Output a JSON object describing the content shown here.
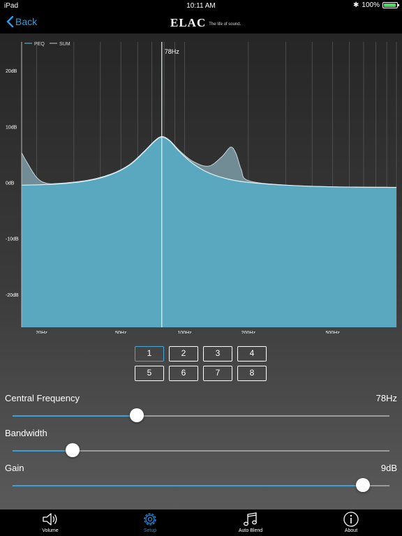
{
  "status_bar": {
    "device": "iPad",
    "time": "10:11 AM",
    "battery": "100%"
  },
  "nav": {
    "back_label": "Back",
    "brand": "ELAC",
    "tagline": "The life of sound."
  },
  "legend": {
    "peq": "PEQ",
    "sum": "SUM"
  },
  "colors": {
    "accent": "#2a9fe6",
    "fill": "#5aa8c0",
    "sum_fill": "#7c9ca7"
  },
  "chart_data": {
    "type": "area",
    "x_scale": "log",
    "xlim": [
      17,
      1000
    ],
    "ylim": [
      -25,
      26
    ],
    "y_ticks": [
      20,
      10,
      0,
      -10,
      -20
    ],
    "y_tick_labels": [
      "20dB",
      "10dB",
      "0dB",
      "-10dB",
      "-20dB"
    ],
    "x_ticks": [
      20,
      50,
      100,
      200,
      500
    ],
    "x_tick_labels": [
      "20Hz",
      "50Hz",
      "100Hz",
      "200Hz",
      "500Hz"
    ],
    "marker": {
      "freq": 78,
      "label": "78Hz"
    },
    "series": [
      {
        "name": "PEQ",
        "x": [
          17,
          25,
          35,
          45,
          55,
          65,
          72,
          78,
          85,
          95,
          110,
          130,
          160,
          200,
          300,
          500,
          1000
        ],
        "y": [
          0.4,
          0.6,
          1.2,
          2.3,
          4.0,
          6.5,
          8.2,
          9.0,
          8.3,
          6.3,
          4.2,
          2.6,
          1.5,
          0.9,
          0.4,
          0.1,
          0.0
        ]
      },
      {
        "name": "SUM",
        "x": [
          17,
          18,
          20,
          22,
          25,
          35,
          45,
          55,
          65,
          72,
          78,
          85,
          95,
          110,
          130,
          150,
          165,
          175,
          185,
          200,
          300,
          500,
          1000
        ],
        "y": [
          6.2,
          4.5,
          1.8,
          0.8,
          0.7,
          1.3,
          2.4,
          4.1,
          6.6,
          8.3,
          9.1,
          8.4,
          6.5,
          4.6,
          3.8,
          5.5,
          7.2,
          6.0,
          3.2,
          1.2,
          0.4,
          0.1,
          0.0
        ]
      }
    ]
  },
  "presets": [
    "1",
    "2",
    "3",
    "4",
    "5",
    "6",
    "7",
    "8"
  ],
  "active_preset": 0,
  "controls": {
    "central_frequency": {
      "label": "Central Frequency",
      "value": "78Hz",
      "level": 0.33
    },
    "bandwidth": {
      "label": "Bandwidth",
      "value": "",
      "level": 0.16
    },
    "gain": {
      "label": "Gain",
      "value": "9dB",
      "level": 0.93
    }
  },
  "tabs": [
    {
      "label": "Volume",
      "icon": "speaker-icon"
    },
    {
      "label": "Setup",
      "icon": "gear-icon"
    },
    {
      "label": "Auto Blend",
      "icon": "music-note-icon"
    },
    {
      "label": "About",
      "icon": "info-icon"
    }
  ],
  "active_tab": 1
}
